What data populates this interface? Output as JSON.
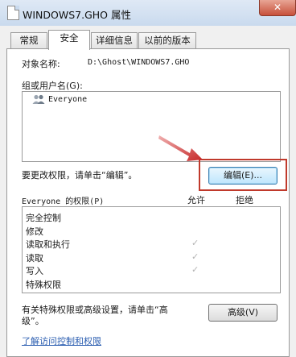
{
  "window": {
    "title": "WINDOWS7.GHO 属性",
    "close_label": "✕"
  },
  "tabs": [
    {
      "label": "常规"
    },
    {
      "label": "安全"
    },
    {
      "label": "详细信息"
    },
    {
      "label": "以前的版本"
    }
  ],
  "security": {
    "object_label": "对象名称:",
    "object_value": "D:\\Ghost\\WINDOWS7.GHO",
    "groups_label": "组或用户名(G):",
    "groups": [
      {
        "name": "Everyone",
        "icon": "users-icon"
      }
    ],
    "change_hint": "要更改权限，请单击“编辑”。",
    "edit_button": "编辑(E)...",
    "perm_label": "Everyone 的权限(P)",
    "allow_header": "允许",
    "deny_header": "拒绝",
    "permissions": [
      {
        "name": "完全控制",
        "allow": false,
        "deny": false
      },
      {
        "name": "修改",
        "allow": false,
        "deny": false
      },
      {
        "name": "读取和执行",
        "allow": true,
        "deny": false
      },
      {
        "name": "读取",
        "allow": true,
        "deny": false
      },
      {
        "name": "写入",
        "allow": true,
        "deny": false
      },
      {
        "name": "特殊权限",
        "allow": false,
        "deny": false
      }
    ],
    "check_glyph": "✓",
    "advanced_hint_line1": "有关特殊权限或高级设置，请单击“高",
    "advanced_hint_line2": "级”。",
    "advanced_button": "高级(V)",
    "learn_link": "了解访问控制和权限"
  },
  "colors": {
    "annotation_arrow": "#d04040",
    "highlight_box": "#c0392b"
  }
}
